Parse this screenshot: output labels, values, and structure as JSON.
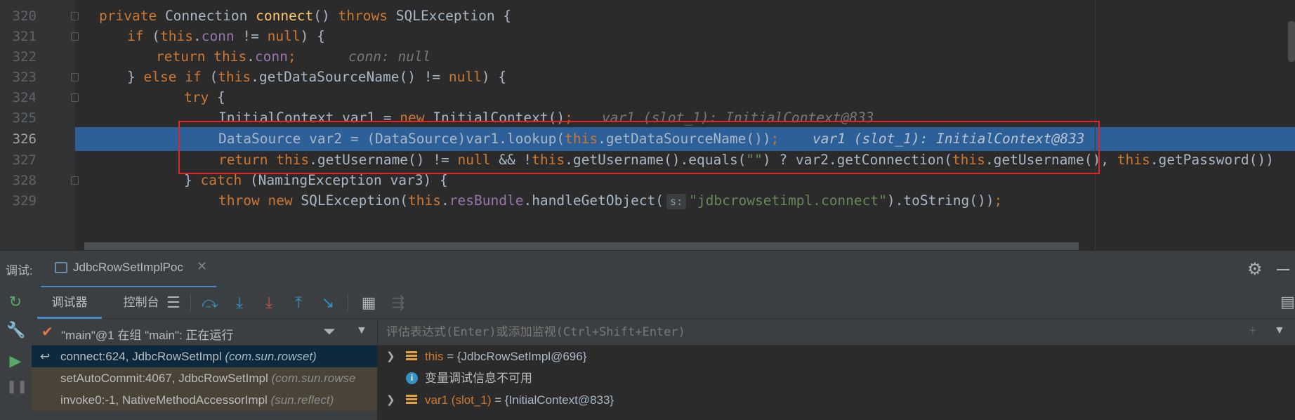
{
  "editor": {
    "lines": [
      {
        "no": "320"
      },
      {
        "no": "321"
      },
      {
        "no": "322"
      },
      {
        "no": "323"
      },
      {
        "no": "324"
      },
      {
        "no": "325"
      },
      {
        "no": "326"
      },
      {
        "no": "327"
      },
      {
        "no": "328"
      },
      {
        "no": "329"
      }
    ],
    "current_line": "326",
    "code": {
      "l320": {
        "kw1": "private",
        "type": "Connection",
        "method": "connect",
        "rest": "()",
        "kw2": "throws",
        "tail": "SQLException {"
      },
      "l321": {
        "kw": "if",
        "p1": "(",
        "this": "this",
        "dot": ".",
        "field": "conn",
        "op": " != ",
        "null": "null",
        "tail": ") {"
      },
      "l322": {
        "kw": "return",
        "this": "this",
        "dot": ".",
        "field": "conn",
        "semi": ";",
        "hint": "conn: null"
      },
      "l323": {
        "p1": "} ",
        "kw1": "else",
        "kw2": "if",
        "p2": "(",
        "this": "this",
        "call": ".getDataSourceName() != ",
        "null": "null",
        "tail": ") {"
      },
      "l324": {
        "kw": "try",
        "tail": " {"
      },
      "l325": {
        "p1": "InitialContext var1 = ",
        "kw": "new",
        "p2": " InitialContext()",
        "semi": ";",
        "hint": "var1 (slot_1): InitialContext@833"
      },
      "l326": {
        "p1": "DataSource var2 = (DataSource)var1.lookup(",
        "this": "this",
        "p2": ".getDataSourceName())",
        "semi": ";",
        "hint": "var1 (slot_1): InitialContext@833"
      },
      "l327": {
        "kw": "return",
        "this1": "this",
        "p1": ".getUsername() != ",
        "null": "null",
        "p2": " && !",
        "this2": "this",
        "p3": ".getUsername().equals(",
        "str": "\"\"",
        "p4": ") ? var2.getConnection(",
        "this3": "this",
        "p5": ".getUsername(), ",
        "this4": "this",
        "p6": ".getPassword())"
      },
      "l328": {
        "p1": "} ",
        "kw": "catch",
        "tail": " (NamingException var3) {"
      },
      "l329": {
        "kw1": "throw",
        "kw2": "new",
        "p1": " SQLException(",
        "this": "this",
        "dot": ".",
        "field": "resBundle",
        "p2": ".handleGetObject(",
        "badge": "s:",
        "str": "\"jdbcrowsetimpl.connect\"",
        "tail": ").toString())",
        "semi": ";"
      }
    }
  },
  "debug": {
    "title": "调试:",
    "session_tab": "JdbcRowSetImplPoc",
    "tabs": [
      {
        "label": "调试器"
      },
      {
        "label": "控制台"
      }
    ],
    "thread": "\"main\"@1 在组 \"main\": 正在运行",
    "frames": [
      {
        "method": "connect:624, JdbcRowSetImpl",
        "pkg": "(com.sun.rowset)"
      },
      {
        "method": "setAutoCommit:4067, JdbcRowSetImpl",
        "pkg": "(com.sun.rowse"
      },
      {
        "method": "invoke0:-1, NativeMethodAccessorImpl",
        "pkg": "(sun.reflect)"
      }
    ],
    "eval_placeholder": "评估表达式(Enter)或添加监视(Ctrl+Shift+Enter)",
    "variables": [
      {
        "name": "this",
        "eq": " = ",
        "value": "{JdbcRowSetImpl@696}"
      },
      {
        "text": "变量调试信息不可用"
      },
      {
        "name": "var1 (slot_1)",
        "eq": " = ",
        "value": "{InitialContext@833}"
      }
    ]
  },
  "colors": {
    "editor_bg": "#2b2b2b",
    "keyword": "#cc7832",
    "field": "#9876aa",
    "method_decl": "#ffc66d",
    "string": "#6a8759",
    "execution_line": "#2d5f99",
    "annotation_box": "#e0242a",
    "resume_green": "#59a869"
  },
  "icons": [
    "fold-icon",
    "debug-session-icon",
    "close-icon",
    "gear-icon",
    "minimize-icon",
    "rerun-icon",
    "wrench-icon",
    "resume-icon",
    "pause-icon",
    "frames-list-icon",
    "step-over-icon",
    "step-into-icon",
    "force-step-into-icon",
    "step-out-icon",
    "run-to-cursor-icon",
    "evaluate-icon",
    "trace-icon",
    "layout-icon",
    "check-icon",
    "filter-icon",
    "chevron-down-icon",
    "return-arrow-icon",
    "expand-arrow-icon",
    "field-icon",
    "info-icon",
    "add-watch-icon"
  ]
}
